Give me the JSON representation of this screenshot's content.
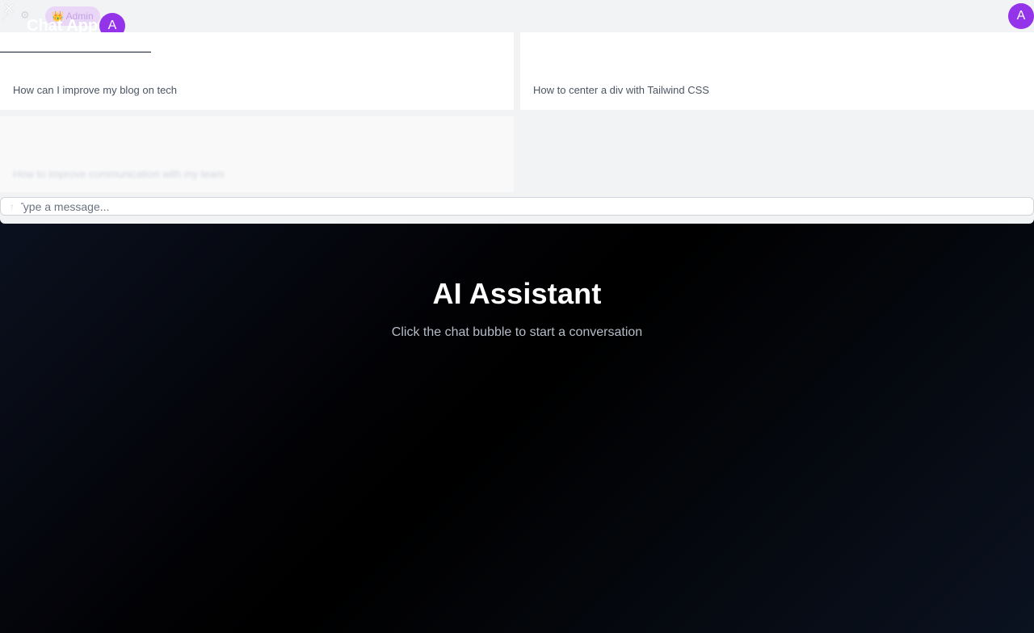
{
  "hero": {
    "title": "AI Assistant",
    "subtitle": "Click the chat bubble to start a conversation"
  },
  "chat": {
    "app_title": "Chat App",
    "admin_badge": "👑 Admin",
    "avatar_letter": "A",
    "close_icon": "close-icon",
    "expand_icon": "expand-icon",
    "settings_icon": "settings-icon",
    "suggestions": [
      "How can I improve my blog on tech",
      "How to center a div with Tailwind CSS",
      "How to improve communication with my team"
    ],
    "input": {
      "placeholder": "Type a message...",
      "value": ""
    },
    "send_icon": "arrow-up-icon"
  },
  "colors": {
    "accent": "#9333ea",
    "badge_bg": "#ead7f7",
    "panel_bg": "#f2f3f5"
  }
}
